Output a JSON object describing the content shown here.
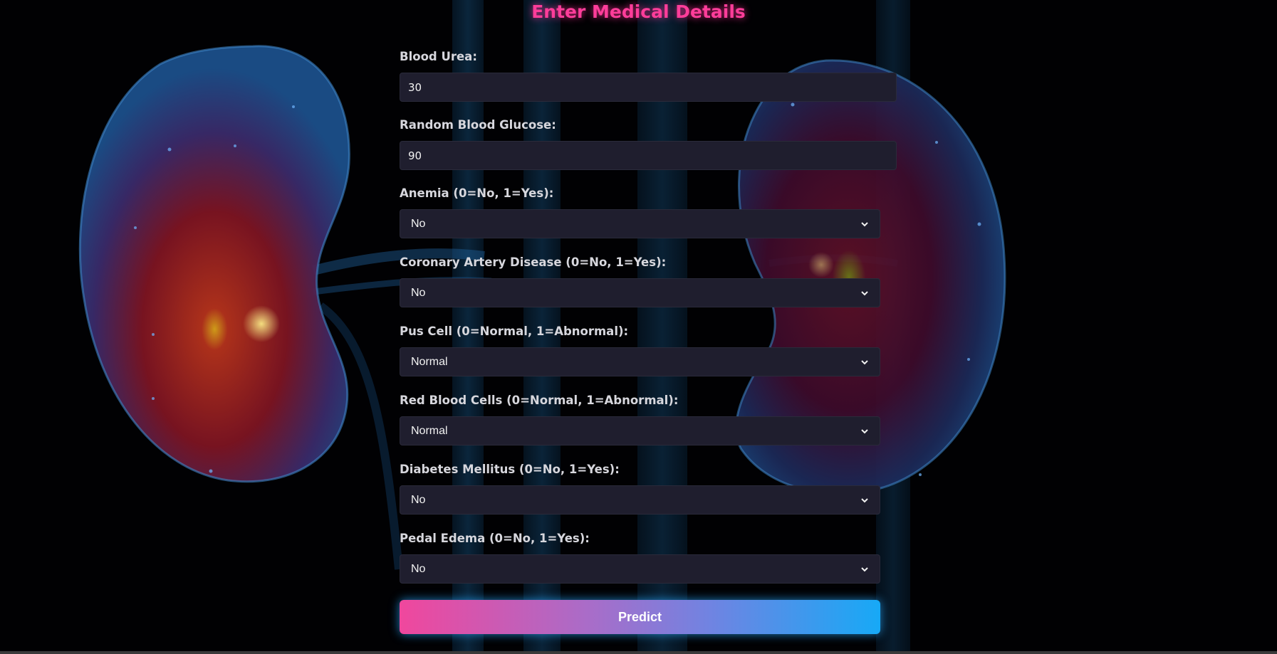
{
  "form": {
    "title": "Enter Medical Details",
    "fields": [
      {
        "label": "Blood Urea:",
        "type": "text",
        "value": "30"
      },
      {
        "label": "Random Blood Glucose:",
        "type": "text",
        "value": "90"
      },
      {
        "label": "Anemia (0=No, 1=Yes):",
        "type": "select",
        "value": "No"
      },
      {
        "label": "Coronary Artery Disease (0=No, 1=Yes):",
        "type": "select",
        "value": "No"
      },
      {
        "label": "Pus Cell (0=Normal, 1=Abnormal):",
        "type": "select",
        "value": "Normal"
      },
      {
        "label": "Red Blood Cells (0=Normal, 1=Abnormal):",
        "type": "select",
        "value": "Normal"
      },
      {
        "label": "Diabetes Mellitus (0=No, 1=Yes):",
        "type": "select",
        "value": "No"
      },
      {
        "label": "Pedal Edema (0=No, 1=Yes):",
        "type": "select",
        "value": "No"
      }
    ],
    "submit_label": "Predict"
  },
  "colors": {
    "title": "#ff3d9a",
    "input_background": "#1f1e2e",
    "button_gradient_start": "#f0479d",
    "button_gradient_end": "#17a9f6"
  },
  "icons": {
    "select_arrow": "chevron-down-icon",
    "background": "kidney-illustration"
  }
}
